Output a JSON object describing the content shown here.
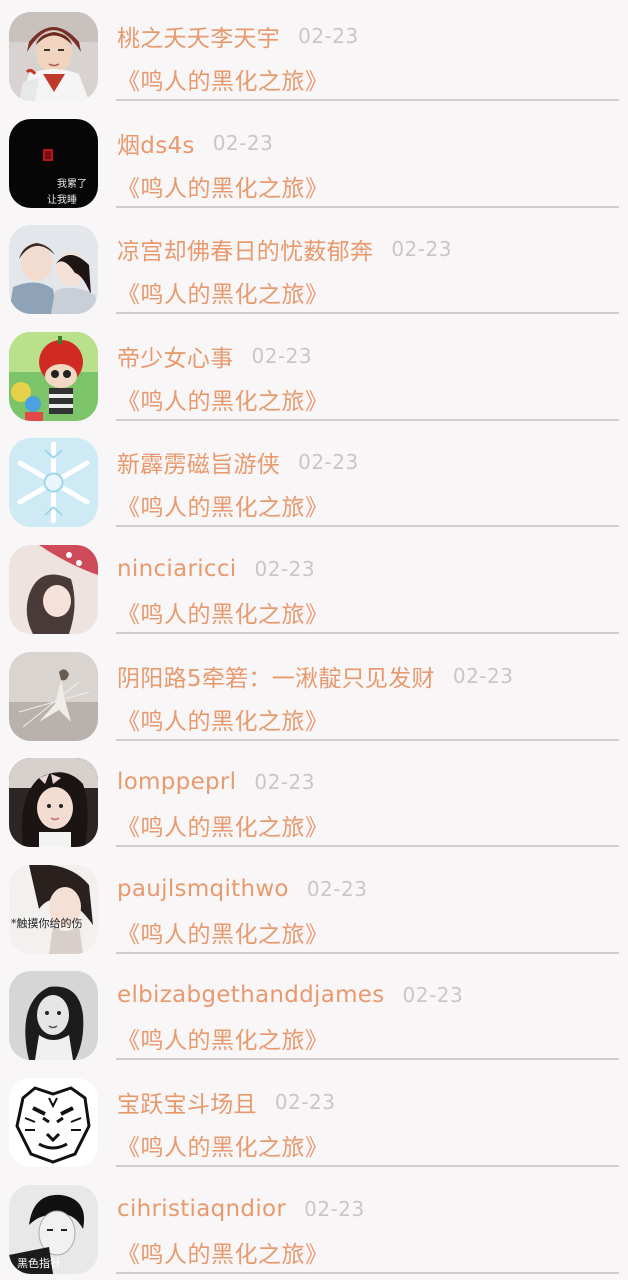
{
  "items": [
    {
      "name": "桃之夭夭李天宇",
      "date": "02-23",
      "title": "《鸣人的黑化之旅》",
      "avatar_icon": "anime-character-avatar"
    },
    {
      "name": "烟ds4s",
      "date": "02-23",
      "title": "《鸣人的黑化之旅》",
      "avatar_icon": "dark-text-avatar",
      "avatar_text": [
        "我累了",
        "让我睡"
      ]
    },
    {
      "name": "凉宫却佛春日的忧薮郁奔",
      "date": "02-23",
      "title": "《鸣人的黑化之旅》",
      "avatar_icon": "couple-photo-avatar"
    },
    {
      "name": "帝少女心事",
      "date": "02-23",
      "title": "《鸣人的黑化之旅》",
      "avatar_icon": "toy-doll-avatar"
    },
    {
      "name": "新霹雳磁旨游侠",
      "date": "02-23",
      "title": "《鸣人的黑化之旅》",
      "avatar_icon": "snowflake-avatar"
    },
    {
      "name": "ninciaricci",
      "date": "02-23",
      "title": "《鸣人的黑化之旅》",
      "avatar_icon": "girl-photo-avatar"
    },
    {
      "name": "阴阳路5牵箬：一湫靛只见发财",
      "date": "02-23",
      "title": "《鸣人的黑化之旅》",
      "avatar_icon": "dancer-photo-avatar"
    },
    {
      "name": "lomppeprl",
      "date": "02-23",
      "title": "《鸣人的黑化之旅》",
      "avatar_icon": "girl-bow-avatar"
    },
    {
      "name": "paujlsmqithwo",
      "date": "02-23",
      "title": "《鸣人的黑化之旅》",
      "avatar_icon": "girl-caption-avatar",
      "avatar_text": [
        "*触摸你给的伤"
      ]
    },
    {
      "name": "elbizabgethanddjames",
      "date": "02-23",
      "title": "《鸣人的黑化之旅》",
      "avatar_icon": "bw-girl-avatar"
    },
    {
      "name": "宝跃宝斗场且",
      "date": "02-23",
      "title": "《鸣人的黑化之旅》",
      "avatar_icon": "tiger-avatar"
    },
    {
      "name": "cihristiaqndior",
      "date": "02-23",
      "title": "《鸣人的黑化之旅》",
      "avatar_icon": "bw-boy-avatar",
      "avatar_text": [
        "黑色指针"
      ]
    }
  ],
  "colors": {
    "background": "#f8f6f7",
    "name": "#e89a6e",
    "title": "#e89a6e",
    "date": "#c9c6c7",
    "divider": "#cfcdce"
  }
}
